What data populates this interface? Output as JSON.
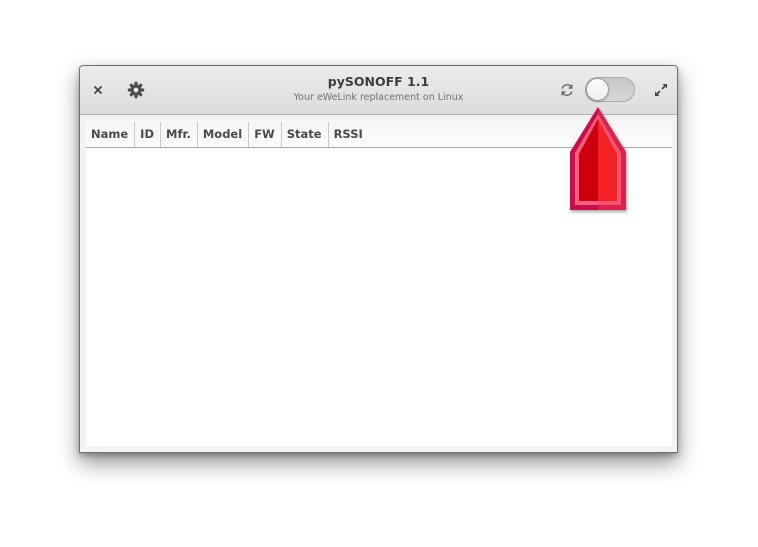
{
  "window": {
    "title": "pySONOFF 1.1",
    "subtitle": "Your eWeLink replacement on Linux"
  },
  "headerbar": {
    "close_icon": "close-icon",
    "settings_icon": "gear-icon",
    "refresh_icon": "refresh-icon",
    "toggle_state": "off",
    "expand_icon": "expand-icon"
  },
  "table": {
    "columns": [
      "Name",
      "ID",
      "Mfr.",
      "Model",
      "FW",
      "State",
      "RSSI"
    ],
    "rows": []
  },
  "annotation": {
    "type": "red-arrow-pointer",
    "color": "#e00010",
    "points_to": "toggle-switch"
  }
}
